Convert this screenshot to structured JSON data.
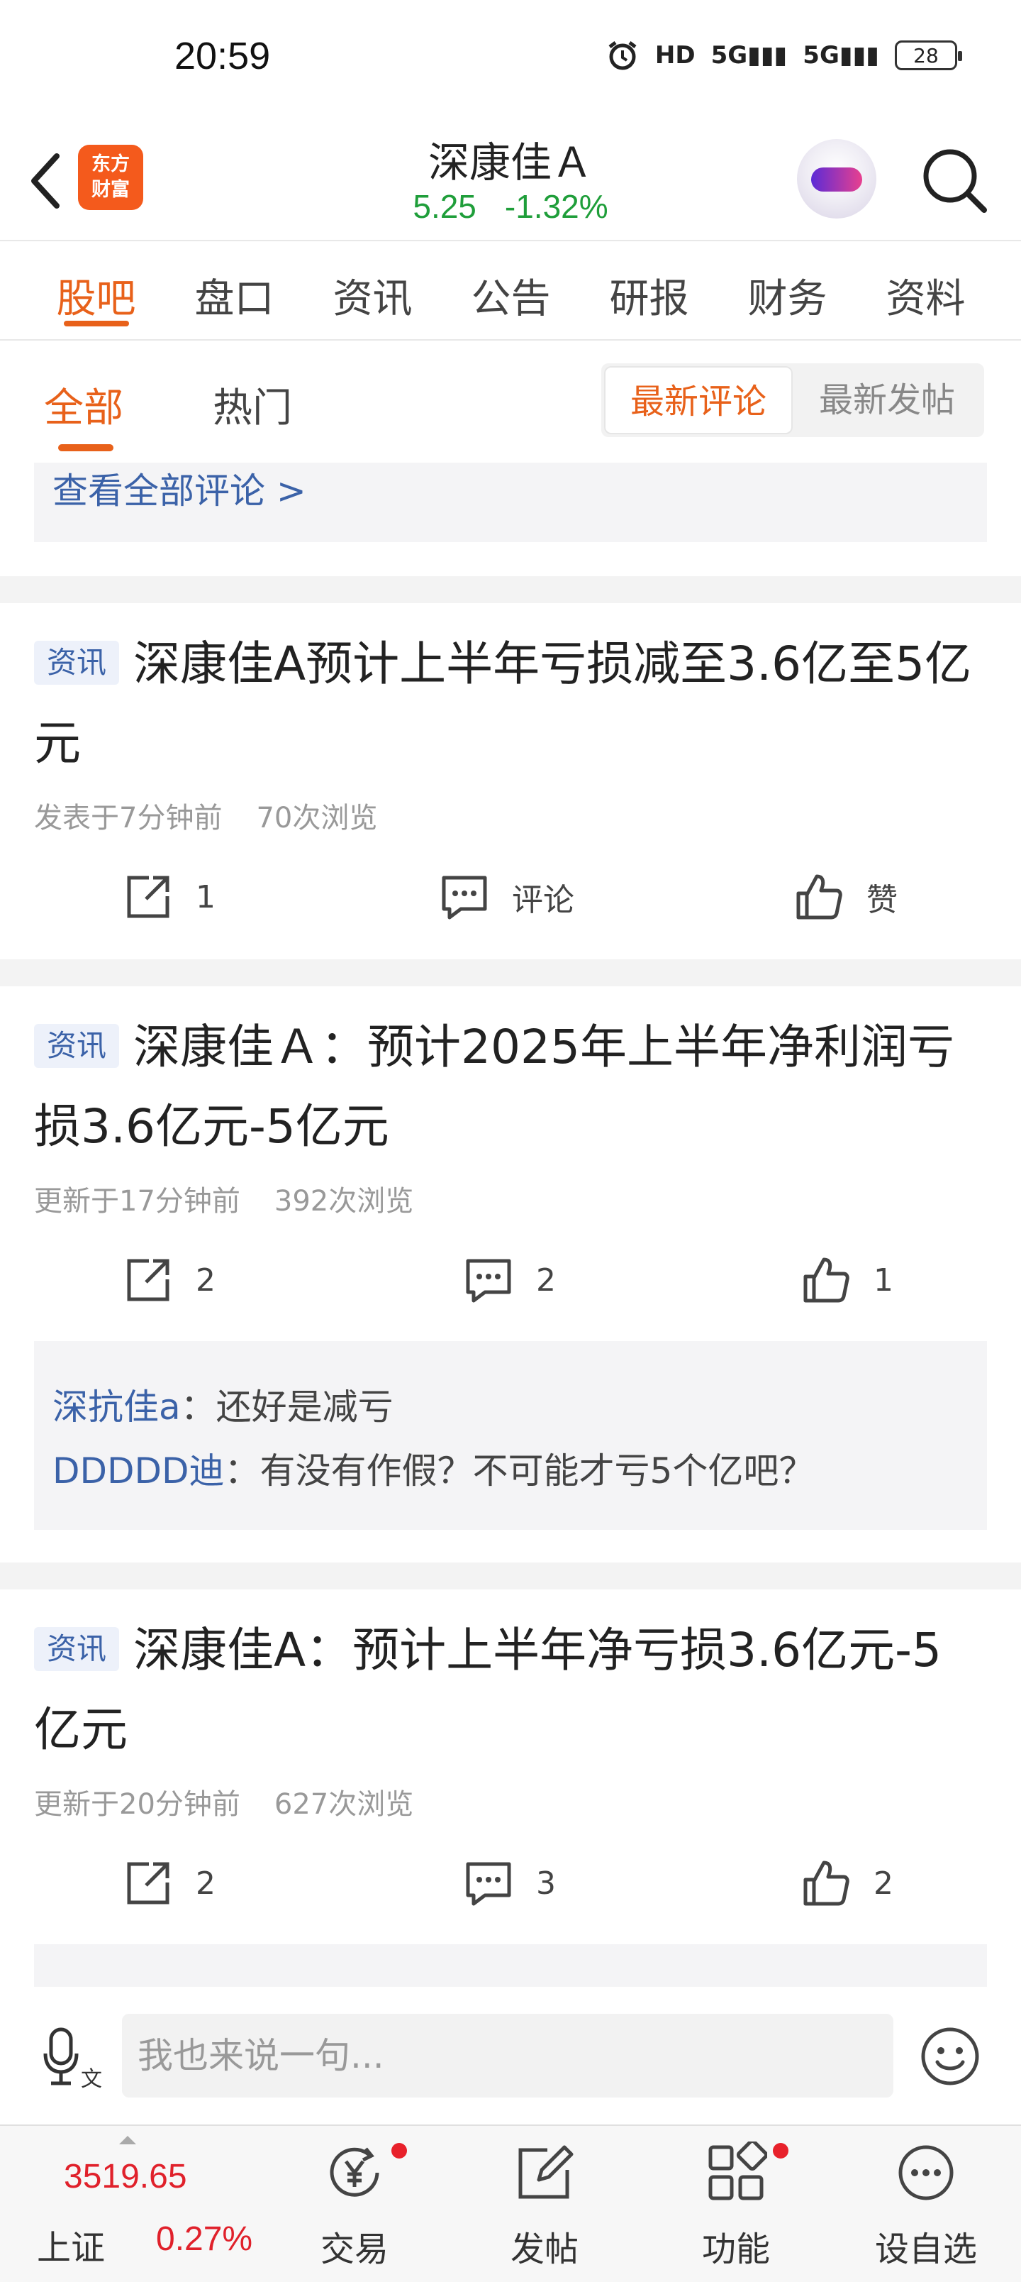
{
  "status_bar": {
    "time": "20:59",
    "hd": "HD",
    "net1": "5G",
    "net2": "5G",
    "battery": "28"
  },
  "header": {
    "logo_text_line1": "东方",
    "logo_text_line2": "财富",
    "stock_name": "深康佳Ａ",
    "price": "5.25",
    "change": "-1.32%"
  },
  "main_tabs": [
    {
      "label": "股吧",
      "active": true
    },
    {
      "label": "盘口"
    },
    {
      "label": "资讯"
    },
    {
      "label": "公告"
    },
    {
      "label": "研报"
    },
    {
      "label": "财务"
    },
    {
      "label": "资料"
    }
  ],
  "sub_tabs": {
    "all": "全部",
    "hot": "热门",
    "latest_comment": "最新评论",
    "latest_post": "最新发帖"
  },
  "view_all_comments": "查看全部评论 >",
  "posts": [
    {
      "tag": "资讯",
      "title": "深康佳A预计上半年亏损减至3.6亿至5亿元",
      "meta_time": "发表于7分钟前",
      "meta_views": "70次浏览",
      "share": "1",
      "comment": "评论",
      "like": "赞"
    },
    {
      "tag": "资讯",
      "title": "深康佳Ａ：预计2025年上半年净利润亏损3.6亿元-5亿元",
      "meta_time": "更新于17分钟前",
      "meta_views": "392次浏览",
      "share": "2",
      "comment": "2",
      "like": "1",
      "replies": [
        {
          "user": "深抗佳a",
          "text": "：还好是减亏"
        },
        {
          "user": "DDDDD迪",
          "text": "：有没有作假？不可能才亏5个亿吧？"
        }
      ]
    },
    {
      "tag": "资讯",
      "title": "深康佳A：预计上半年净亏损3.6亿元-5亿元",
      "meta_time": "更新于20分钟前",
      "meta_views": "627次浏览",
      "share": "2",
      "comment": "3",
      "like": "2"
    }
  ],
  "input_placeholder": "我也来说一句...",
  "bottom_nav": {
    "index_value": "3519.65",
    "index_name": "上证",
    "index_pct": "0.27%",
    "items": [
      "交易",
      "发帖",
      "功能",
      "设自选"
    ]
  },
  "colors": {
    "accent": "#e8611a",
    "down": "#1f9e3a",
    "up": "#e0212b",
    "link": "#3b62a8"
  }
}
